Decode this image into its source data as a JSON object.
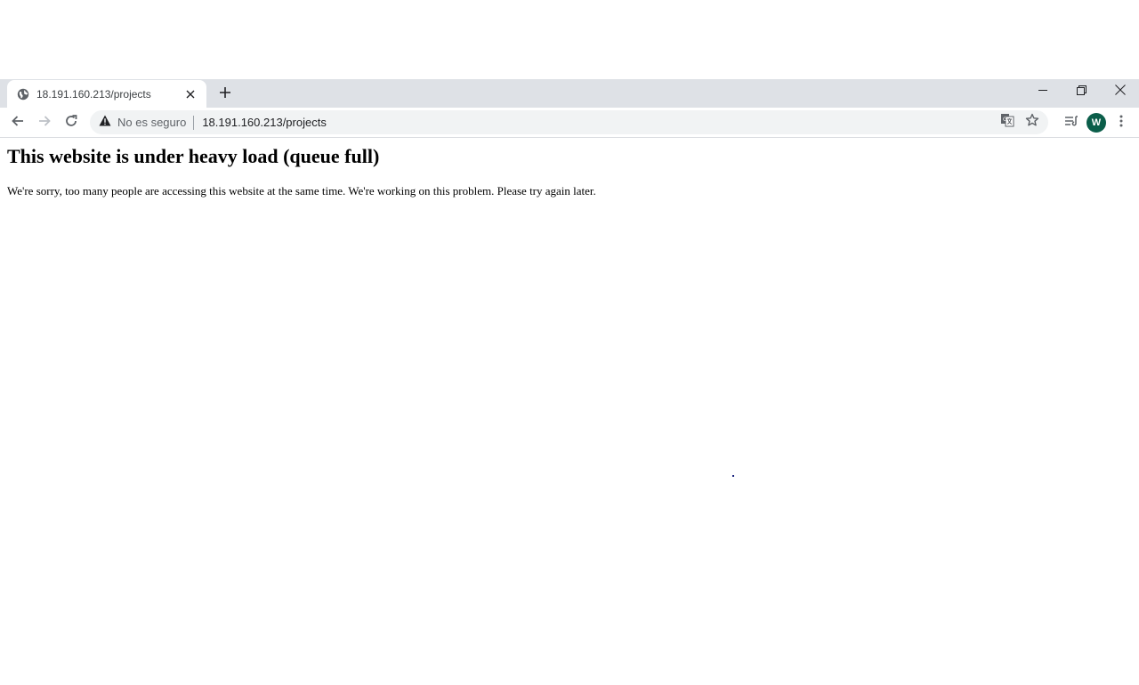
{
  "browser": {
    "tab": {
      "title": "18.191.160.213/projects",
      "favicon_icon": "globe-icon",
      "close_icon": "close-icon"
    },
    "new_tab_icon": "plus-icon",
    "window_controls": {
      "minimize_icon": "minimize-icon",
      "restore_icon": "restore-icon",
      "close_icon": "close-icon"
    },
    "toolbar": {
      "back_icon": "arrow-left-icon",
      "forward_icon": "arrow-right-icon",
      "reload_icon": "reload-icon",
      "security_label": "No es seguro",
      "security_icon": "warning-icon",
      "url": "18.191.160.213/projects",
      "translate_icon": "translate-icon",
      "bookmark_icon": "star-icon",
      "reading_list_icon": "reading-list-icon",
      "profile_initial": "W",
      "profile_color": "#0b5e4a",
      "menu_icon": "kebab-menu-icon"
    }
  },
  "page": {
    "heading": "This website is under heavy load (queue full)",
    "message": "We're sorry, too many people are accessing this website at the same time. We're working on this problem. Please try again later."
  }
}
